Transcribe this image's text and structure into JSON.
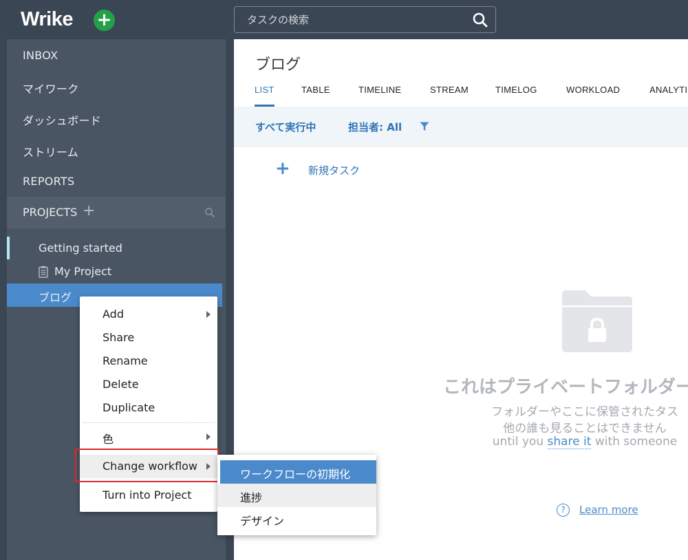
{
  "app": {
    "logo": "Wrike",
    "colors": {
      "topbar": "#3b4654",
      "sidebar": "#4a5563",
      "accent": "#2f74b5",
      "add_button": "#24a148",
      "highlight_outline": "#e0262b"
    }
  },
  "search": {
    "placeholder": "タスクの検索",
    "icon": "search-icon"
  },
  "sidebar": {
    "nav": [
      {
        "label": "INBOX"
      },
      {
        "label": "マイワーク"
      },
      {
        "label": "ダッシュボード"
      },
      {
        "label": "ストリーム"
      },
      {
        "label": "REPORTS"
      }
    ],
    "projects_label": "PROJECTS",
    "projects_add": "+",
    "tree": [
      {
        "label": "Getting started"
      },
      {
        "label": "My Project",
        "icon": "clipboard-icon"
      },
      {
        "label": "ブログ",
        "selected": true
      }
    ]
  },
  "main": {
    "title": "ブログ",
    "tabs": [
      {
        "label": "LIST",
        "active": true
      },
      {
        "label": "TABLE"
      },
      {
        "label": "TIMELINE"
      },
      {
        "label": "STREAM"
      },
      {
        "label": "TIMELOG"
      },
      {
        "label": "WORKLOAD"
      },
      {
        "label": "ANALYTI"
      }
    ],
    "filters": {
      "status": "すべて実行中",
      "assignee": "担当者: All"
    },
    "new_task": {
      "icon": "+",
      "label": "新規タスク"
    },
    "empty_state": {
      "heading": "これはプライベートフォルダー",
      "line1": "フォルダーやここに保管されたタス",
      "line2": "他の誰も見ることはできません",
      "line3_prefix": "until you ",
      "line3_link": "share it",
      "line3_suffix": " with someone",
      "help_icon": "?",
      "learn_more": "Learn more"
    }
  },
  "context_menu": {
    "items": [
      {
        "label": "Add",
        "submenu": true
      },
      {
        "label": "Share"
      },
      {
        "label": "Rename"
      },
      {
        "label": "Delete"
      },
      {
        "label": "Duplicate"
      },
      {
        "label": "色",
        "submenu": true
      },
      {
        "label": "Change workflow",
        "submenu": true,
        "hover": true
      },
      {
        "label": "Turn into Project"
      }
    ]
  },
  "workflow_submenu": {
    "items": [
      {
        "label": "ワークフローの初期化",
        "selected": true
      },
      {
        "label": "進捗",
        "hover": true
      },
      {
        "label": "デザイン"
      }
    ]
  }
}
